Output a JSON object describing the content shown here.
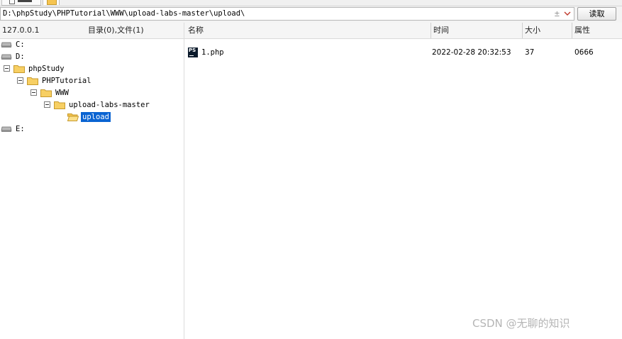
{
  "address": {
    "path": "D:\\phpStudy\\PHPTutorial\\WWW\\upload-labs-master\\upload\\",
    "plusminus_glyph": "±",
    "read_label": "读取"
  },
  "left_header": {
    "host": "127.0.0.1",
    "counts": "目录(0),文件(1)"
  },
  "columns": {
    "name": "名称",
    "time": "时间",
    "size": "大小",
    "attr": "属性"
  },
  "tree": {
    "drive_c": "C:",
    "drive_d": "D:",
    "phpstudy": "phpStudy",
    "phptutorial": "PHPTutorial",
    "www": "WWW",
    "upload_labs": "upload-labs-master",
    "upload": "upload",
    "drive_e": "E:"
  },
  "files": [
    {
      "icon": "phpstorm-file-icon",
      "icon_text": "PS",
      "name": "1.php",
      "time": "2022-02-28 20:32:53",
      "size": "37",
      "attr": "0666"
    }
  ],
  "watermark": "CSDN @无聊的知识",
  "colors": {
    "selection": "#0a64d2",
    "folder": "#f5c451"
  }
}
